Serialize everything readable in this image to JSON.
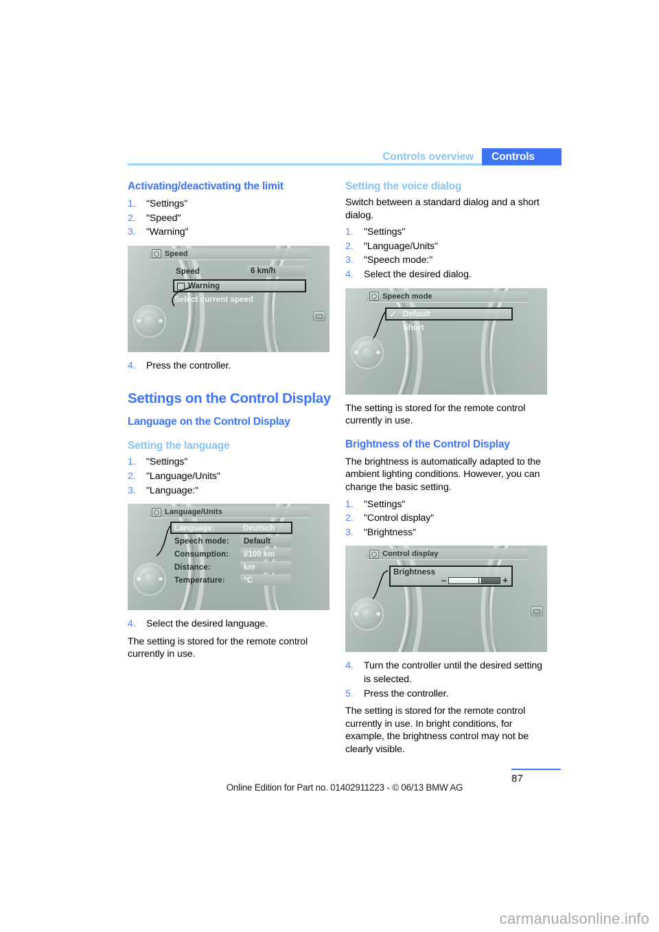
{
  "header": {
    "breadcrumb_secondary": "Controls overview",
    "tab_active": "Controls",
    "accent_blue": "#3d73f5",
    "accent_light_blue": "#8bc4f2"
  },
  "left_column": {
    "heading_activating": "Activating/deactivating the limit",
    "steps_activating": [
      {
        "num": "1.",
        "text": "\"Settings\""
      },
      {
        "num": "2.",
        "text": "\"Speed\""
      },
      {
        "num": "3.",
        "text": "\"Warning\""
      }
    ],
    "speed_screenshot": {
      "title": "Speed",
      "label_speed": "Speed",
      "value_speed": "6 km/h",
      "highlight_label": "Warning",
      "hint": "Select current speed"
    },
    "step_after_speed": {
      "num": "4.",
      "text": "Press the controller."
    },
    "heading_settings_control_display": "Settings on the Control Display",
    "heading_language": "Language on the Control Display",
    "subheading_setting_language": "Setting the language",
    "steps_language": [
      {
        "num": "1.",
        "text": "\"Settings\""
      },
      {
        "num": "2.",
        "text": "\"Language/Units\""
      },
      {
        "num": "3.",
        "text": "\"Language:\""
      }
    ],
    "language_screenshot": {
      "title": "Language/Units",
      "rows": [
        {
          "label": "Language:",
          "value": "Deutsch",
          "highlighted": true
        },
        {
          "label": "Speech mode:",
          "value": "Default",
          "highlighted": false
        },
        {
          "label": "Consumption:",
          "value": "l/100 km",
          "highlighted": false
        },
        {
          "label": "Distance:",
          "value": "km",
          "highlighted": false
        },
        {
          "label": "Temperature:",
          "value": "°C",
          "highlighted": false
        }
      ]
    },
    "step_select_language": {
      "num": "4.",
      "text": "Select the desired language."
    },
    "note_stored": "The setting is stored for the remote control currently in use."
  },
  "right_column": {
    "subheading_voice_dialog": "Setting the voice dialog",
    "intro_voice_dialog": "Switch between a standard dialog and a short dialog.",
    "steps_voice": [
      {
        "num": "1.",
        "text": "\"Settings\""
      },
      {
        "num": "2.",
        "text": "\"Language/Units\""
      },
      {
        "num": "3.",
        "text": "\"Speech mode:\""
      },
      {
        "num": "4.",
        "text": "Select the desired dialog."
      }
    ],
    "speech_screenshot": {
      "title": "Speech mode",
      "option_selected": "Default",
      "option_other": "Short"
    },
    "note_stored": "The setting is stored for the remote control currently in use.",
    "heading_brightness": "Brightness of the Control Display",
    "intro_brightness": "The brightness is automatically adapted to the ambient lighting conditions. However, you can change the basic setting.",
    "steps_brightness": [
      {
        "num": "1.",
        "text": "\"Settings\""
      },
      {
        "num": "2.",
        "text": "\"Control display\""
      },
      {
        "num": "3.",
        "text": "\"Brightness\""
      }
    ],
    "brightness_screenshot": {
      "title": "Control display",
      "label": "Brightness",
      "minus": "–",
      "plus": "+",
      "level_percent": 62
    },
    "steps_brightness_after": [
      {
        "num": "4.",
        "text": "Turn the controller until the desired setting is selected."
      },
      {
        "num": "5.",
        "text": "Press the controller."
      }
    ],
    "note_brightness": "The setting is stored for the remote control currently in use. In bright conditions, for example, the brightness control may not be clearly visible."
  },
  "footer": {
    "page_number": "87",
    "edition_line": "Online Edition for Part no. 01402911223 - © 06/13 BMW AG",
    "watermark": "carmanualsonline.info"
  }
}
